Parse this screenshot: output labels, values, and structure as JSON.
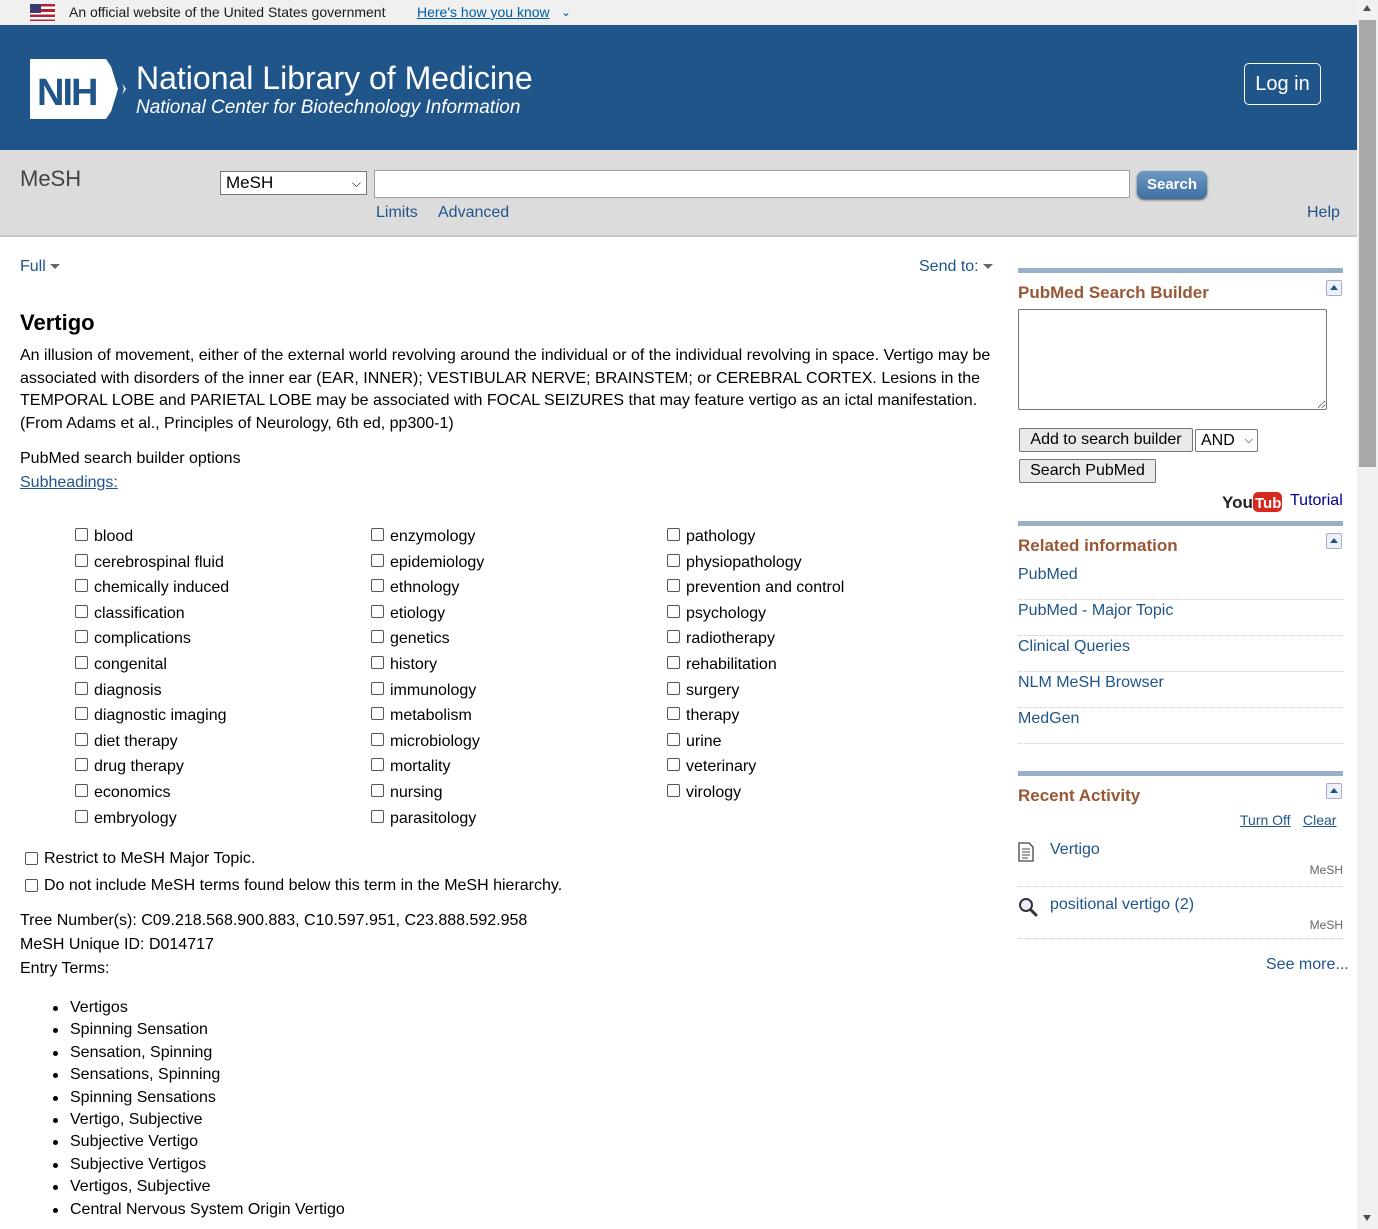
{
  "gov_banner": {
    "text": "An official website of the United States government",
    "link": "Here's how you know"
  },
  "header": {
    "logo_text": "NIH",
    "title": "National Library of Medicine",
    "subtitle": "National Center for Biotechnology Information",
    "login": "Log in",
    "color": "#20558a"
  },
  "searchbar": {
    "db_name": "MeSH",
    "db_select": "MeSH",
    "query": "",
    "search_label": "Search",
    "limits": "Limits",
    "advanced": "Advanced",
    "help": "Help"
  },
  "display": {
    "format": "Full",
    "send_to": "Send to:"
  },
  "record": {
    "title": "Vertigo",
    "scope_note": "An illusion of movement, either of the external world revolving around the individual or of the individual revolving in space. Vertigo may be associated with disorders of the inner ear (EAR, INNER); VESTIBULAR NERVE; BRAINSTEM; or CEREBRAL CORTEX. Lesions in the TEMPORAL LOBE and PARIETAL LOBE may be associated with FOCAL SEIZURES that may feature vertigo as an ictal manifestation. (From Adams et al., Principles of Neurology, 6th ed, pp300-1)",
    "builder_options": "PubMed search builder options",
    "subheadings_label": "Subheadings:",
    "subheadings": [
      [
        "blood",
        "cerebrospinal fluid",
        "chemically induced",
        "classification",
        "complications",
        "congenital",
        "diagnosis",
        "diagnostic imaging",
        "diet therapy",
        "drug therapy",
        "economics",
        "embryology"
      ],
      [
        "enzymology",
        "epidemiology",
        "ethnology",
        "etiology",
        "genetics",
        "history",
        "immunology",
        "metabolism",
        "microbiology",
        "mortality",
        "nursing",
        "parasitology"
      ],
      [
        "pathology",
        "physiopathology",
        "prevention and control",
        "psychology",
        "radiotherapy",
        "rehabilitation",
        "surgery",
        "therapy",
        "urine",
        "veterinary",
        "virology"
      ]
    ],
    "restrict_major": "Restrict to MeSH Major Topic.",
    "no_explode": "Do not include MeSH terms found below this term in the MeSH hierarchy.",
    "tree_numbers": "Tree Number(s): C09.218.568.900.883, C10.597.951, C23.888.592.958",
    "unique_id": "MeSH Unique ID: D014717",
    "entry_terms_label": "Entry Terms:",
    "entry_terms": [
      "Vertigos",
      "Spinning Sensation",
      "Sensation, Spinning",
      "Sensations, Spinning",
      "Spinning Sensations",
      "Vertigo, Subjective",
      "Subjective Vertigo",
      "Subjective Vertigos",
      "Vertigos, Subjective",
      "Central Nervous System Origin Vertigo"
    ]
  },
  "sidebar": {
    "builder": {
      "title": "PubMed Search Builder",
      "add_button": "Add to search builder",
      "operator": "AND",
      "search_button": "Search PubMed",
      "youtube": "YouTube",
      "tutorial": "Tutorial"
    },
    "related": {
      "title": "Related information",
      "links": [
        "PubMed",
        "PubMed - Major Topic",
        "Clinical Queries",
        "NLM MeSH Browser",
        "MedGen"
      ]
    },
    "recent": {
      "title": "Recent Activity",
      "turn_off": "Turn Off",
      "clear": "Clear",
      "items": [
        {
          "label": "Vertigo",
          "db": "MeSH",
          "icon": "document-icon"
        },
        {
          "label": "positional vertigo (2)",
          "db": "MeSH",
          "icon": "magnifier-icon"
        }
      ],
      "see_more": "See more..."
    }
  }
}
